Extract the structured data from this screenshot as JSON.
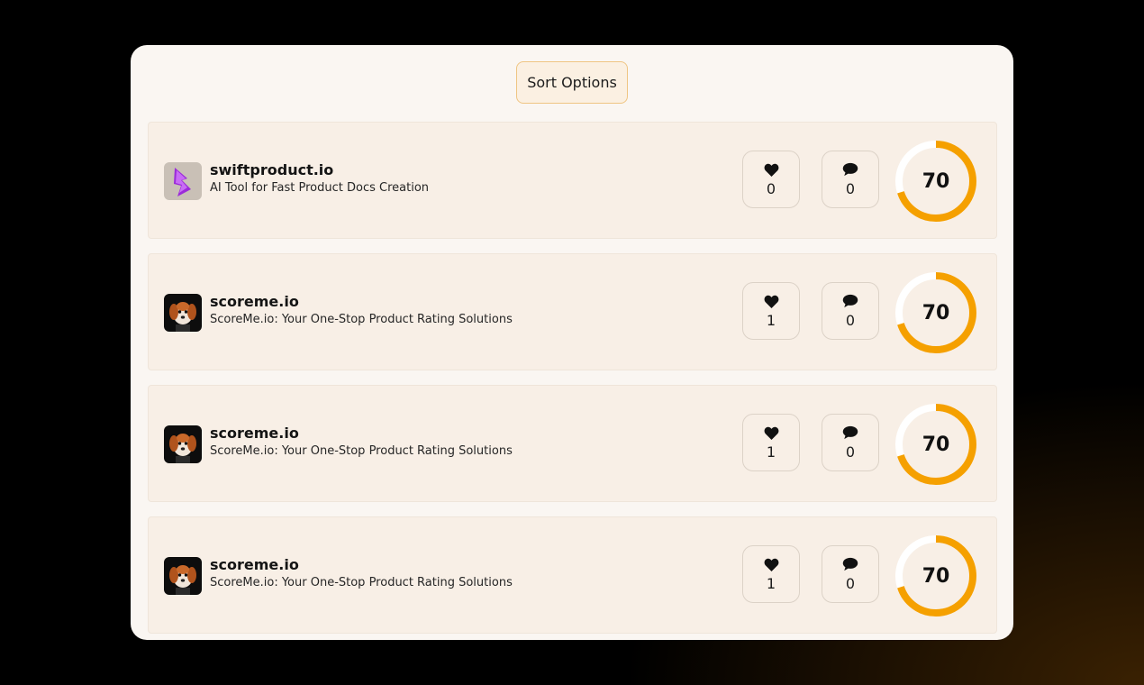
{
  "sort_button_label": "Sort Options",
  "products": [
    {
      "name": "swiftproduct.io",
      "tagline": "AI Tool for Fast Product Docs Creation",
      "logo": "lightning-bolt-logo",
      "likes": "0",
      "comments": "0",
      "score": "70",
      "score_fraction": 0.7
    },
    {
      "name": "scoreme.io",
      "tagline": "ScoreMe.io: Your One-Stop Product Rating Solutions",
      "logo": "dog-logo",
      "likes": "1",
      "comments": "0",
      "score": "70",
      "score_fraction": 0.7
    },
    {
      "name": "scoreme.io",
      "tagline": "ScoreMe.io: Your One-Stop Product Rating Solutions",
      "logo": "dog-logo",
      "likes": "1",
      "comments": "0",
      "score": "70",
      "score_fraction": 0.7
    },
    {
      "name": "scoreme.io",
      "tagline": "ScoreMe.io: Your One-Stop Product Rating Solutions",
      "logo": "dog-logo",
      "likes": "1",
      "comments": "0",
      "score": "70",
      "score_fraction": 0.7
    }
  ],
  "colors": {
    "accent": "#f5a000",
    "ring_track": "#ffffff",
    "panel": "#faf6f2",
    "card": "#f8efe6"
  }
}
